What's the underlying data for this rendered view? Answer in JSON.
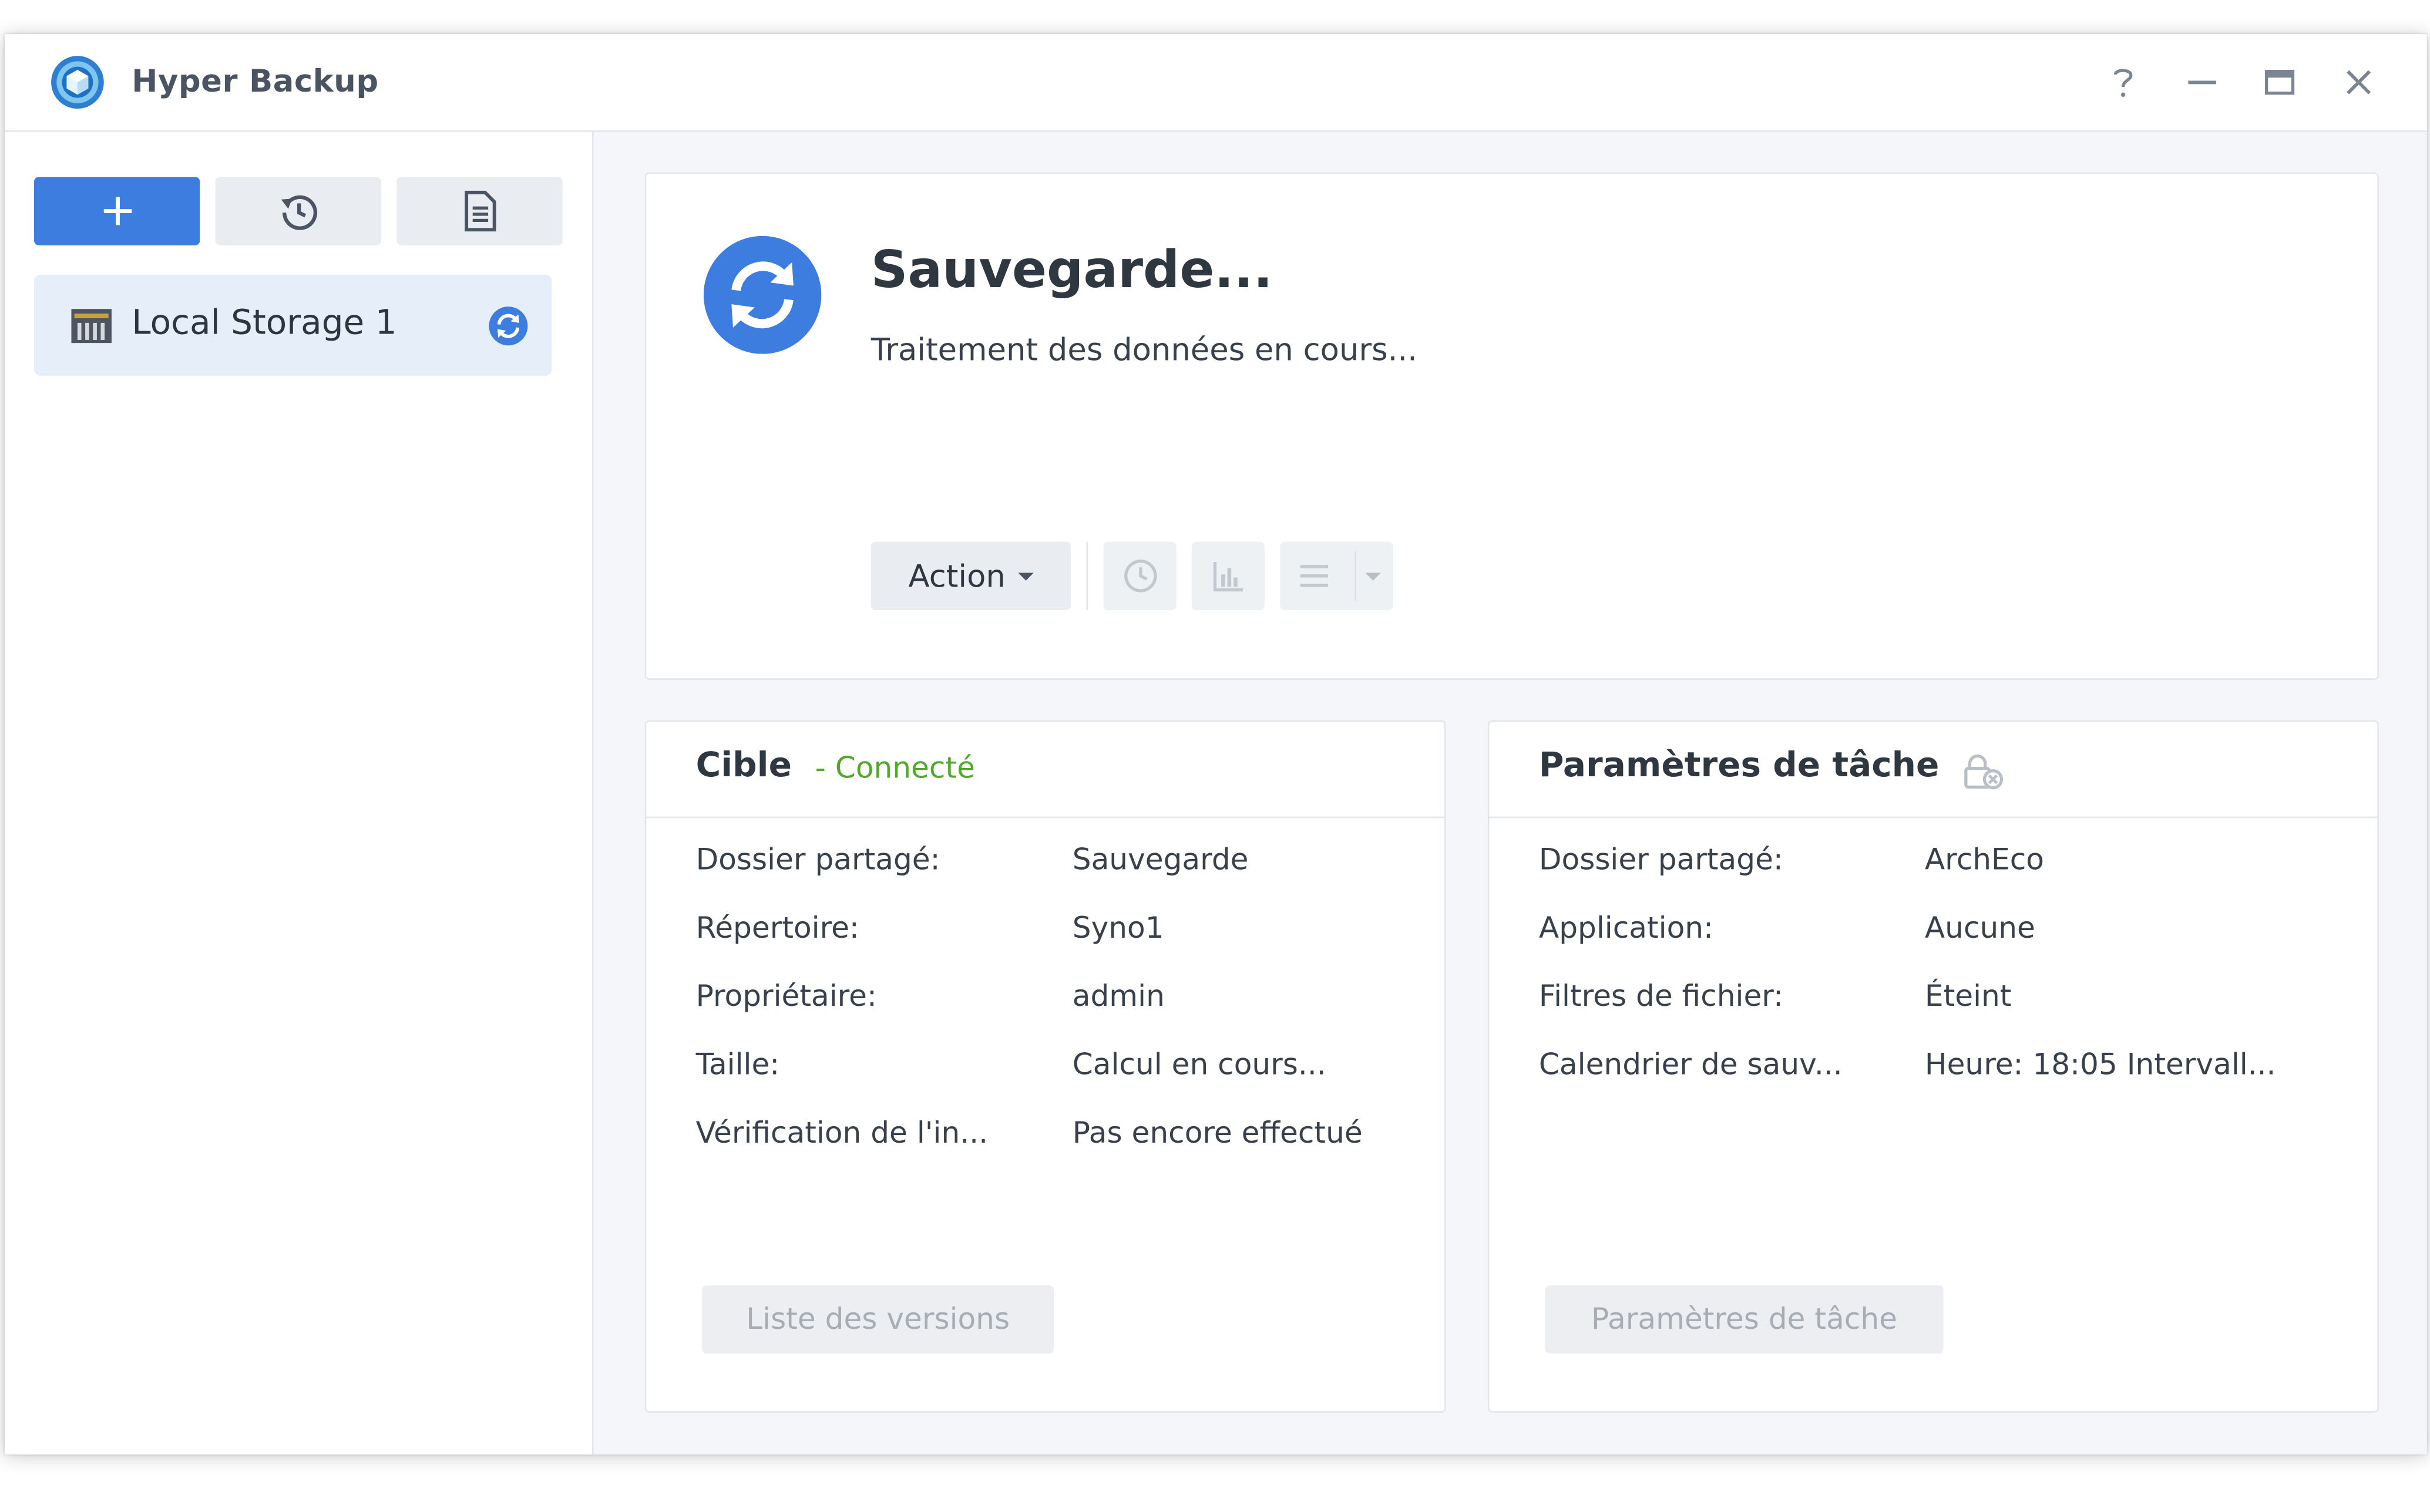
{
  "app": {
    "title": "Hyper Backup",
    "window_controls": [
      "help-icon",
      "minimize-icon",
      "maximize-icon",
      "close-icon"
    ]
  },
  "sidebar": {
    "toolbar": [
      "add-icon",
      "history-icon",
      "log-icon"
    ],
    "tasks": [
      {
        "label": "Local Storage 1",
        "status_icon": "syncing-icon"
      }
    ]
  },
  "status": {
    "title": "Sauvegarde...",
    "subtitle": "Traitement des données en cours...",
    "action_label": "Action",
    "tool_icons": [
      "schedule-icon",
      "statistics-icon",
      "list-icon"
    ]
  },
  "target": {
    "title": "Cible",
    "status": "- Connecté",
    "rows": [
      {
        "label": "Dossier partagé:",
        "value": "Sauvegarde"
      },
      {
        "label": "Répertoire:",
        "value": "Syno1"
      },
      {
        "label": "Propriétaire:",
        "value": "admin"
      },
      {
        "label": "Taille:",
        "value": "Calcul en cours..."
      },
      {
        "label": "Vérification de l'in...",
        "value": "Pas encore effectué"
      }
    ],
    "button_label": "Liste des versions"
  },
  "params": {
    "title": "Paramètres de tâche",
    "rows": [
      {
        "label": "Dossier partagé:",
        "value": "ArchEco"
      },
      {
        "label": "Application:",
        "value": "Aucune"
      },
      {
        "label": "Filtres de fichier:",
        "value": "Éteint"
      },
      {
        "label": "Calendrier de sauv...",
        "value": "Heure: 18:05 Intervall..."
      }
    ],
    "button_label": "Paramètres de tâche"
  },
  "colors": {
    "accent": "#3e7de0",
    "connected": "#52a82c"
  }
}
